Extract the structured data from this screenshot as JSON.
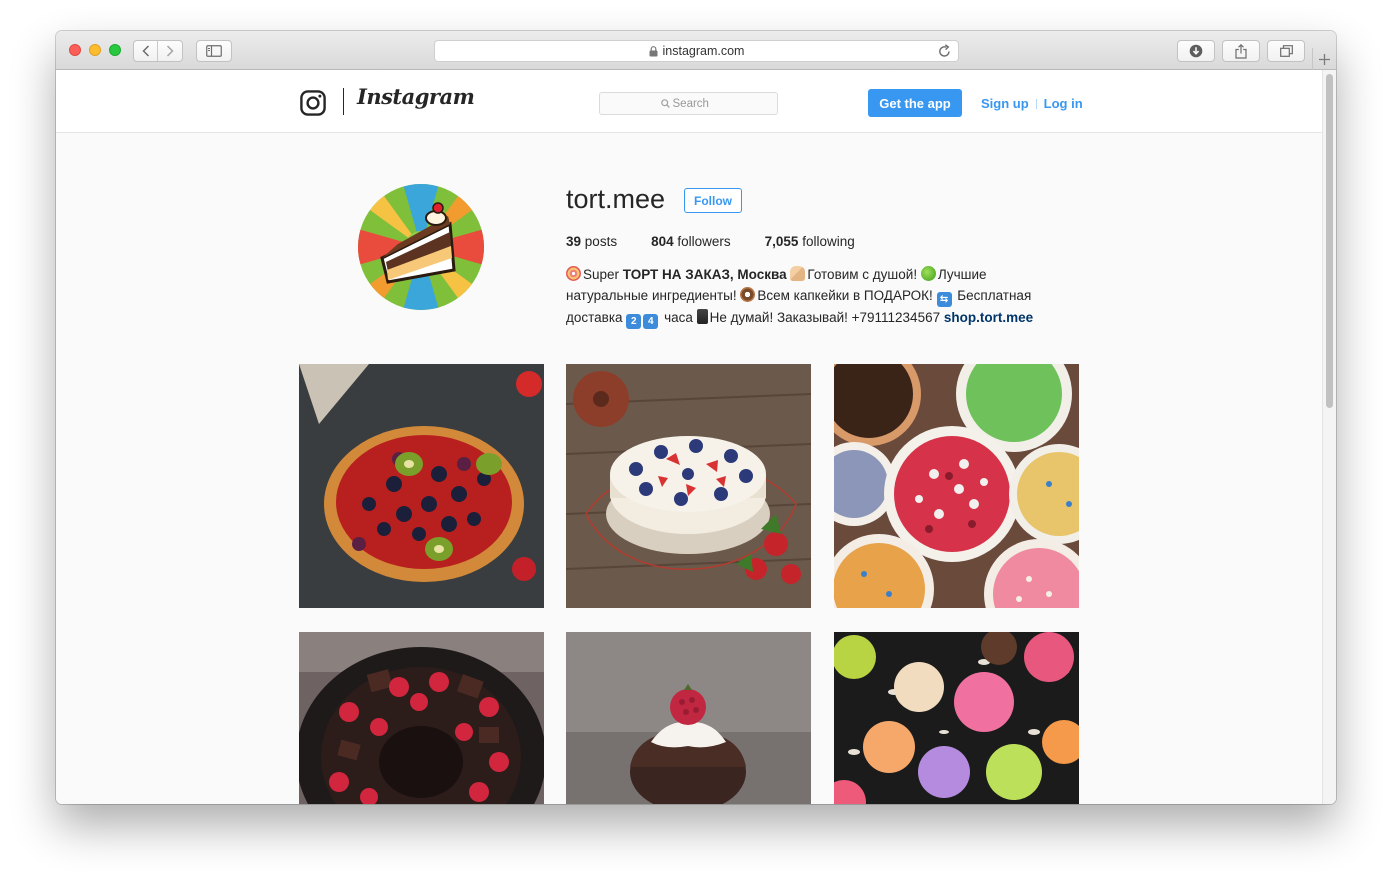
{
  "browser": {
    "url": "instagram.com"
  },
  "header": {
    "brand": "Instagram",
    "search_placeholder": "Search",
    "get_app": "Get the app",
    "sign_up": "Sign up",
    "log_in": "Log in"
  },
  "profile": {
    "username": "tort.mee",
    "follow_label": "Follow",
    "stats": [
      {
        "num": "39",
        "label": "posts"
      },
      {
        "num": "804",
        "label": "followers"
      },
      {
        "num": "7,055",
        "label": "following"
      }
    ],
    "bio": {
      "part1": "Super ",
      "bold1": "ТОРТ НА ЗАКАЗ, Москва",
      "part2": "Готовим с душой! ",
      "part3": "Лучшие натуральные ингредиенты! ",
      "part4": "Всем капкейки в ПОДАРОК! ",
      "part5": " Бесплатная доставка ",
      "key1": "2",
      "key2": "4",
      "part6": " часа ",
      "part7": "Не думай! Заказывай! +79111234567 ",
      "link": "shop.tort.mee"
    }
  },
  "posts": [
    {
      "subject": "berry-tart"
    },
    {
      "subject": "berry-cake"
    },
    {
      "subject": "sprinkles-bowls"
    },
    {
      "subject": "chocolate-raspberry-cake"
    },
    {
      "subject": "raspberry-cupcake"
    },
    {
      "subject": "macarons"
    }
  ]
}
